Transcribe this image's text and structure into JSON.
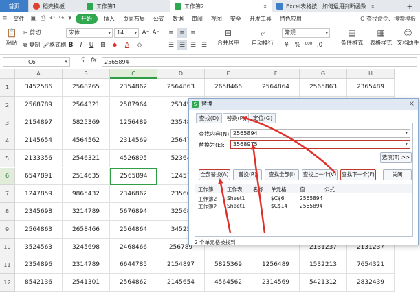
{
  "tabs": [
    {
      "label": "首页",
      "kind": "home"
    },
    {
      "label": "稻壳模板",
      "kind": "normal",
      "icon_color": "#e0402e"
    },
    {
      "label": "工作簿1",
      "kind": "normal",
      "icon_color": "#2fa84f"
    },
    {
      "label": "工作簿2",
      "kind": "active",
      "icon_color": "#2fa84f"
    },
    {
      "label": "Excel表格技...如何运用判断函数",
      "kind": "normal",
      "icon_color": "#3d7ec9"
    }
  ],
  "menu": {
    "file_label": "文件",
    "items": [
      "开始",
      "插入",
      "页面布局",
      "公式",
      "数据",
      "审阅",
      "视图",
      "安全",
      "开发工具",
      "特色应用"
    ],
    "search_label": "Q 查找命令、搜索模板"
  },
  "toolbar": {
    "paste": "粘贴",
    "cut": "剪切",
    "copy": "复制",
    "format_painter": "格式刷",
    "font_name": "宋体",
    "font_size": "14",
    "bold": "B",
    "italic": "I",
    "underline": "U",
    "merge_center": "合并居中",
    "wrap_text": "自动换行",
    "number_format": "常规",
    "currency": "¥",
    "percent": "%",
    "conditional_format": "条件格式",
    "table_style": "表格样式",
    "doc_assistant": "文档助手"
  },
  "formula_bar": {
    "cell_ref": "C6",
    "fx_label": "fx",
    "value": "2565894"
  },
  "grid": {
    "columns": [
      "A",
      "B",
      "C",
      "D",
      "E",
      "F",
      "G",
      "H"
    ],
    "selected_column": "C",
    "selected_row": 6,
    "rows": [
      {
        "num": "1",
        "cells": [
          "3452586",
          "2568265",
          "2354862",
          "2564863",
          "2658466",
          "2564864",
          "2565863",
          "2365489"
        ]
      },
      {
        "num": "2",
        "cells": [
          "2568789",
          "2564321",
          "2587964",
          "25345",
          "",
          "",
          "",
          ""
        ]
      },
      {
        "num": "3",
        "cells": [
          "2154897",
          "5825369",
          "1256489",
          "23548",
          "",
          "",
          "",
          ""
        ]
      },
      {
        "num": "4",
        "cells": [
          "2145654",
          "4564562",
          "2314569",
          "25647",
          "",
          "",
          "",
          ""
        ]
      },
      {
        "num": "5",
        "cells": [
          "2133356",
          "2546321",
          "4526895",
          "52364",
          "",
          "",
          "",
          ""
        ]
      },
      {
        "num": "6",
        "cells": [
          "6547891",
          "2514635",
          "2565894",
          "12457",
          "",
          "",
          "",
          ""
        ]
      },
      {
        "num": "7",
        "cells": [
          "1247859",
          "9865432",
          "2346862",
          "23566",
          "",
          "",
          "",
          ""
        ]
      },
      {
        "num": "8",
        "cells": [
          "2345698",
          "3214789",
          "5676894",
          "32568",
          "",
          "",
          "",
          ""
        ]
      },
      {
        "num": "9",
        "cells": [
          "2564863",
          "2658466",
          "2564864",
          "34525",
          "",
          "",
          "",
          ""
        ]
      },
      {
        "num": "10",
        "cells": [
          "3524563",
          "3245698",
          "2468466",
          "256789",
          "",
          "",
          "2131237",
          "2131237"
        ]
      },
      {
        "num": "11",
        "cells": [
          "2354896",
          "2314789",
          "6644785",
          "2154897",
          "5825369",
          "1256489",
          "1532213",
          "7654321"
        ]
      },
      {
        "num": "12",
        "cells": [
          "8542136",
          "2541301",
          "2564862",
          "2145654",
          "4564562",
          "2314569",
          "5421312",
          "2832439"
        ]
      }
    ]
  },
  "dialog": {
    "title": "替换",
    "close": "×",
    "tabs": [
      "查找(D)",
      "替换(P)",
      "定位(G)"
    ],
    "active_tab": 1,
    "find_label": "查找内容(N):",
    "find_value": "2565894",
    "replace_label": "替换为(E):",
    "replace_value": "3568975",
    "options_button": "选项(T) >>",
    "buttons": [
      "全部替换(A)",
      "替换(R)",
      "查找全部(I)",
      "查找上一个(V)",
      "查找下一个(F)",
      "关闭"
    ],
    "results_headers": [
      "工作簿",
      "工作表",
      "名称",
      "单元格",
      "值",
      "公式"
    ],
    "results_rows": [
      [
        "工作簿2",
        "Sheet1",
        "",
        "$C$6",
        "2565894",
        ""
      ],
      [
        "工作簿2",
        "Sheet1",
        "",
        "$C$14",
        "2565894",
        ""
      ]
    ],
    "status": "2 个单元格被找到"
  },
  "colors": {
    "accent_green": "#2fa84f",
    "annotation_red": "#e0302a",
    "selection_border": "#2f9e47"
  }
}
